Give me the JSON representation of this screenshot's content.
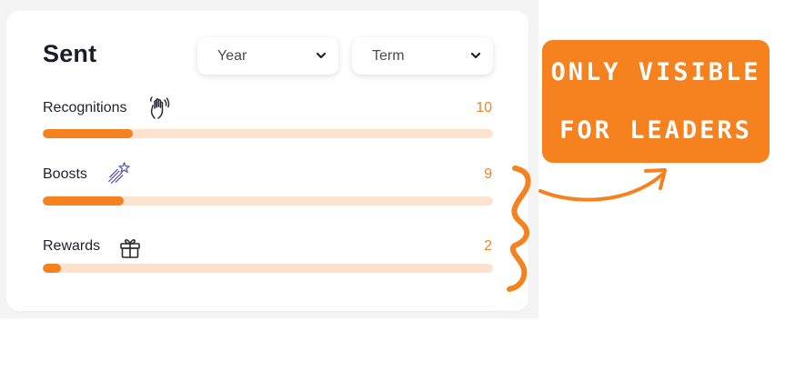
{
  "card": {
    "title": "Sent",
    "filters": [
      {
        "label": "Year"
      },
      {
        "label": "Term"
      }
    ],
    "metrics": [
      {
        "label": "Recognitions",
        "icon": "waving-hand-icon",
        "value": "10",
        "fill_percent": 20
      },
      {
        "label": "Boosts",
        "icon": "shooting-star-icon",
        "value": "9",
        "fill_percent": 18
      },
      {
        "label": "Rewards",
        "icon": "gift-icon",
        "value": "2",
        "fill_percent": 4
      }
    ]
  },
  "annotation": {
    "line1": "ONLY VISIBLE",
    "line2": "FOR LEADERS"
  },
  "colors": {
    "accent": "#f5811f",
    "track": "#fde3cd",
    "title": "#1b1c2b",
    "value": "#f58220"
  }
}
